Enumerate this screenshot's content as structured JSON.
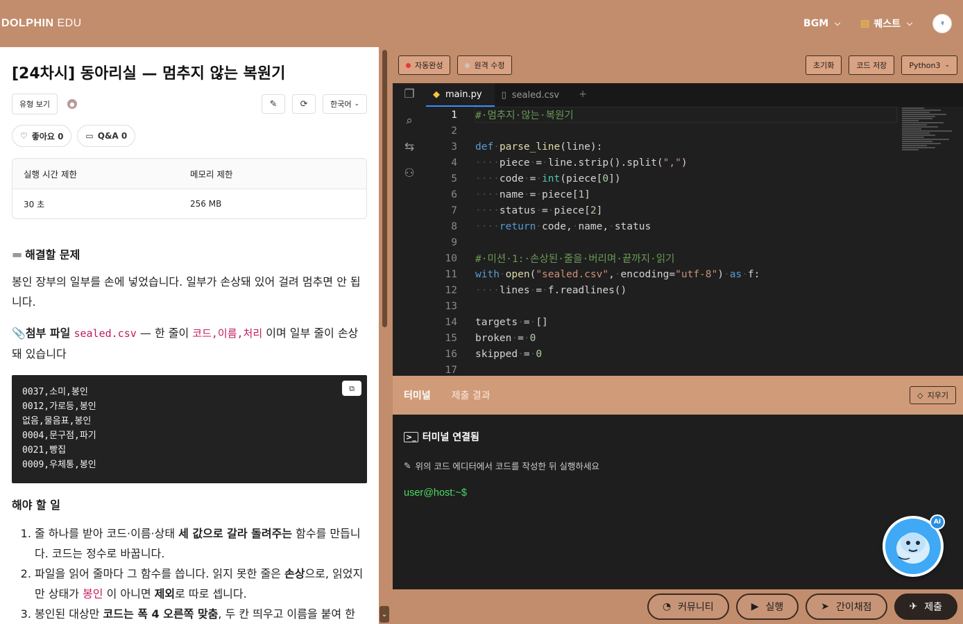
{
  "topbar": {
    "brand_bold": "DOLPHIN",
    "brand_light": "EDU",
    "bgm_label": "BGM",
    "quest_label": "퀘스트",
    "avatar_text": "ꟻ"
  },
  "problem": {
    "title": "[24차시] 동아리실 — 멈추지 않는 복원기",
    "type_button": "유형 보기",
    "language": "한국어",
    "likes": "좋아요 0",
    "qna": "Q&A 0",
    "limits": {
      "time_header": "실행 시간 제한",
      "memory_header": "메모리 제한",
      "time_value": "30 초",
      "memory_value": "256 MB"
    },
    "section_heading": "해결할 문제",
    "paragraph1": "봉인 장부의 일부를 손에 넣었습니다. 일부가 손상돼 있어 걸려 멈추면 안 됩니다.",
    "attach": {
      "label": "첨부 파일",
      "file": "sealed.csv",
      "mid": " — 한 줄이 ",
      "fields": "코드,이름,처리",
      "tail": " 이며 일부 줄이 손상돼 있습니다"
    },
    "sample_lines": [
      "0037,소미,봉인",
      "0012,가로등,봉인",
      "없음,물음표,봉인",
      "0004,문구점,파기",
      "0021,빵집",
      "0009,우체통,봉인"
    ],
    "todo_heading": "해야 할 일",
    "todo": [
      {
        "a": "줄 하나를 받아 코드·이름·상태 ",
        "b": "세 값으로 갈라 돌려주는",
        "c": " 함수를 만듭니다. 코드는 정수로 바꿉니다."
      },
      {
        "a": "파일을 읽어 줄마다 그 함수를 씁니다. 읽지 못한 줄은 ",
        "b": "손상",
        "c": "으로, 읽었지만 상태가 ",
        "d": "봉인",
        "e": " 이 아니면 ",
        "f": "제외",
        "g": "로 따로 셉니다."
      },
      {
        "a": "봉인된 대상만 ",
        "b": "코드는 폭 4 오른쪽 맞춤",
        "c": ", 두 칸 띄우고 이름을 붙여 한"
      }
    ]
  },
  "toolbar": {
    "autocomplete": "자동완성",
    "remote_edit": "원격 수정",
    "reset": "초기화",
    "save": "코드 저장",
    "runtime": "Python3"
  },
  "editor": {
    "tabs": [
      "main.py",
      "sealed.csv"
    ],
    "line_numbers": [
      "1",
      "2",
      "3",
      "4",
      "5",
      "6",
      "7",
      "8",
      "9",
      "10",
      "11",
      "12",
      "13",
      "14",
      "15",
      "16",
      "17"
    ]
  },
  "terminal": {
    "tab_terminal": "터미널",
    "tab_result": "제출 결과",
    "clear": "지우기",
    "connected": "터미널 연결됨",
    "hint": "위의 코드 에디터에서 코드를 작성한 뒤 실행하세요",
    "prompt": "user@host:~$",
    "ai_badge": "AI"
  },
  "bottom": {
    "community": "커뮤니티",
    "run": "실행",
    "quick_grade": "간이채점",
    "submit": "제출"
  }
}
